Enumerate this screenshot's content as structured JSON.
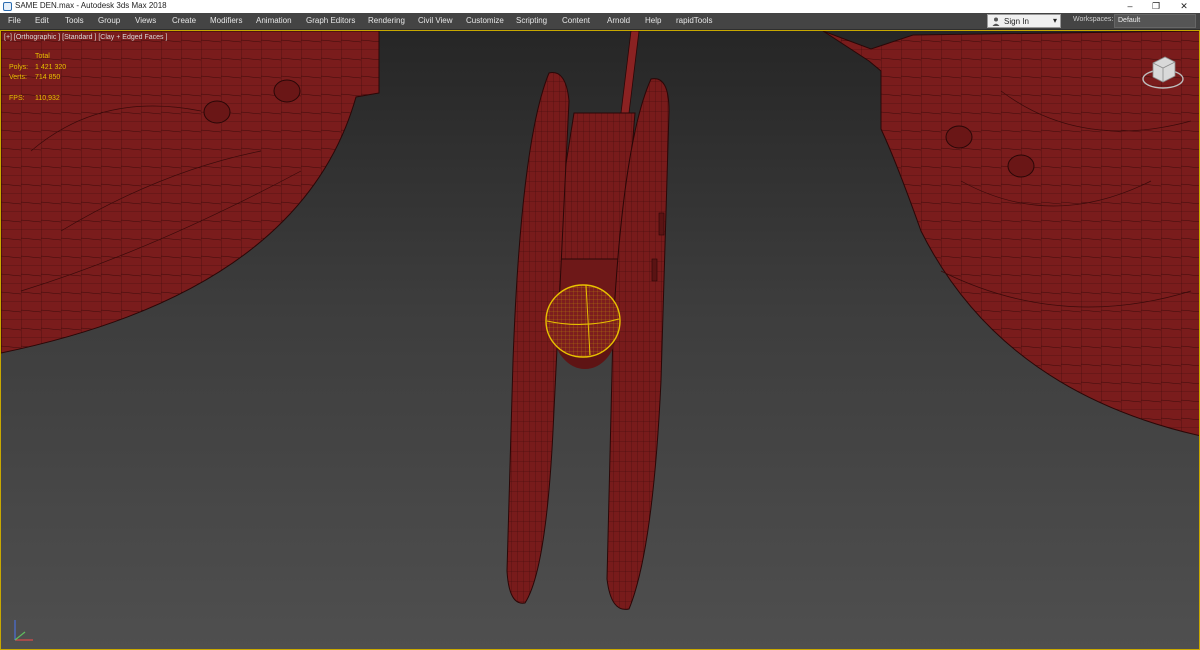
{
  "window": {
    "title": "SAME DEN.max - Autodesk 3ds Max 2018",
    "minimize_glyph": "–",
    "restore_glyph": "❐",
    "close_glyph": "✕"
  },
  "menu": {
    "items": [
      "File",
      "Edit",
      "Tools",
      "Group",
      "Views",
      "Create",
      "Modifiers",
      "Animation",
      "Graph Editors",
      "Rendering",
      "Civil View",
      "Customize",
      "Scripting",
      "Content",
      "Arnold",
      "Help",
      "rapidTools"
    ]
  },
  "account": {
    "signin_label": "Sign In",
    "workspaces_label": "Workspaces:",
    "workspace_value": "Default"
  },
  "viewport": {
    "label": "[+] [Orthographic ] [Standard ] [Clay + Edged Faces ]",
    "stats": {
      "total_label": "Total",
      "polys_label": "Polys:",
      "polys_value": "1 421 320",
      "verts_label": "Verts:",
      "verts_value": "714 850",
      "fps_label": "FPS:",
      "fps_value": "110,932"
    }
  },
  "colors": {
    "mesh_fill": "#7a1c1c",
    "mesh_edge": "#2a0707",
    "selection": "#e8c100",
    "viewport_border": "#c8a800"
  },
  "icons": [
    "app-icon",
    "user-icon",
    "chevron-down-icon",
    "viewcube-icon",
    "axis-gizmo-icon"
  ]
}
